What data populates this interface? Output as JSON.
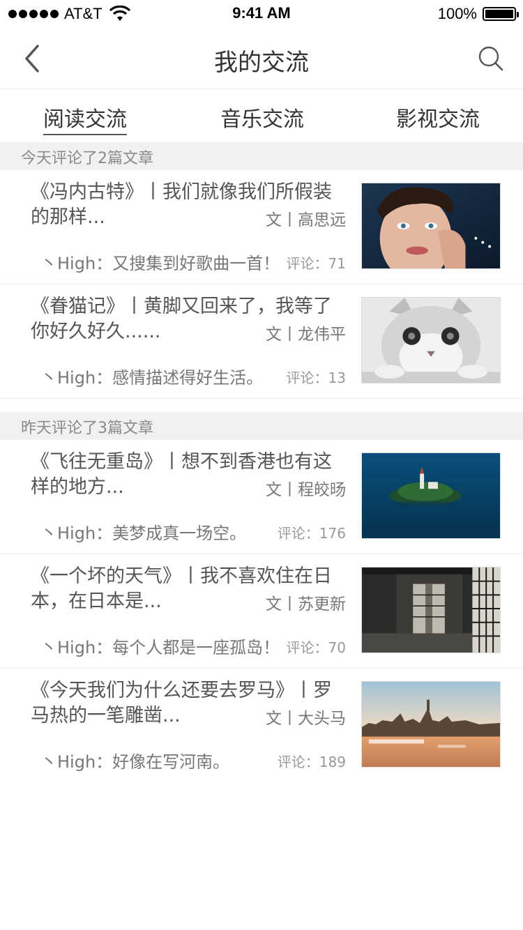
{
  "status_bar": {
    "carrier": "AT&T",
    "time": "9:41 AM",
    "battery": "100%"
  },
  "nav": {
    "title": "我的交流",
    "back_icon": "chevron-left-icon",
    "search_icon": "search-icon"
  },
  "tabs": [
    {
      "label": "阅读交流",
      "active": true
    },
    {
      "label": "音乐交流",
      "active": false
    },
    {
      "label": "影视交流",
      "active": false
    }
  ],
  "sections": [
    {
      "header": "今天评论了2篇文章",
      "items": [
        {
          "title": "《冯内古特》丨我们就像我们所假装的那样...",
          "author": "文丨高思远",
          "comment": "丶High：又搜集到好歌曲一首！",
          "count": "评论：71",
          "thumb": "portrait-photo"
        },
        {
          "title": "《眷猫记》丨黄脚又回来了，我等了你好久好久......",
          "author": "文丨龙伟平",
          "comment": "丶High：感情描述得好生活。",
          "count": "评论：13",
          "thumb": "cat-photo"
        }
      ]
    },
    {
      "header": "昨天评论了3篇文章",
      "items": [
        {
          "title": "《飞往无重岛》丨想不到香港也有这样的地方...",
          "author": "文丨程皎旸",
          "comment": "丶High：美梦成真一场空。",
          "count": "评论：176",
          "thumb": "island-photo"
        },
        {
          "title": "《一个坏的天气》丨我不喜欢住在日本，在日本是...",
          "author": "文丨苏更新",
          "comment": "丶High：每个人都是一座孤岛！",
          "count": "评论：70",
          "thumb": "japanese-room-photo"
        },
        {
          "title": "《今天我们为什么还要去罗马》丨罗马热的一笔雕凿...",
          "author": "文丨大头马",
          "comment": "丶High：好像在写河南。",
          "count": "评论：189",
          "thumb": "city-river-photo"
        }
      ]
    }
  ]
}
